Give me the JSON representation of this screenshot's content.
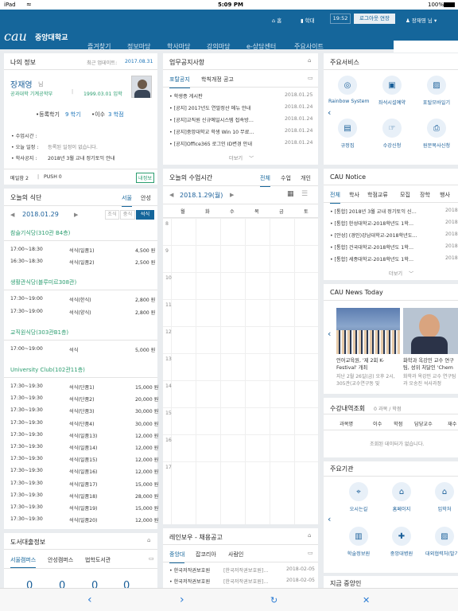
{
  "status": {
    "device": "iPad",
    "time": "5:09 PM",
    "battery": "100%"
  },
  "top": {
    "home": "홈",
    "school": "학대",
    "timer": "19:52",
    "extend": "로그아웃 연장",
    "user": "장재영 님"
  },
  "brand": {
    "logo": "cau",
    "name": "중앙대학교"
  },
  "nav": [
    "즐겨찾기",
    "정보마당",
    "학사마당",
    "강의마당",
    "e-상담센터",
    "주요사이트"
  ],
  "info": {
    "title": "나의 정보",
    "update_label": "최근 업데이트:",
    "update_date": "2017.08.31",
    "name": "장재영",
    "honorific": "님",
    "dept": "공과대학 기계공학부",
    "entry": "1999.03.01 입학",
    "reg_label": "•등록학기",
    "reg_val": "9 학기",
    "trans_label": "•이수",
    "trans_val": "3 학점",
    "class_time": "• 수업시간 :",
    "today_label": "• 오늘 일정 :",
    "today_val": "등록된 일정이 없습니다.",
    "notice_label": "• 학사공지 :",
    "notice_val": "2018년 3월 교내 정기토익 안내",
    "mail": "메일함 2",
    "push": "PUSH 0",
    "mypage": "내정보"
  },
  "menu": {
    "title": "오늘의 식단",
    "tabs": [
      "서울",
      "안성"
    ],
    "date": "2018.01.29",
    "meals": [
      "조식",
      "중식",
      "석식"
    ],
    "sections": [
      {
        "name": "참슬기식당(310관 B4층)",
        "rows": [
          [
            "17:00~18:30",
            "석식(일품1)",
            "4,500 원"
          ],
          [
            "16:30~18:30",
            "석식(일품2)",
            "2,500 원"
          ]
        ]
      },
      {
        "name": "생활관식당(블루미르308관)",
        "rows": [
          [
            "17:30~19:00",
            "석식(한식)",
            "2,800 원"
          ],
          [
            "17:30~19:00",
            "석식(양식)",
            "2,800 원"
          ]
        ]
      },
      {
        "name": "교직원식당(303관B1층)",
        "rows": [
          [
            "17:00~19:00",
            "석식",
            "5,000 원"
          ]
        ]
      },
      {
        "name": "University Club(102관11층)",
        "rows": [
          [
            "17:30~19:30",
            "석식(단품1)",
            "15,000 원"
          ],
          [
            "17:30~19:30",
            "석식(단품2)",
            "20,000 원"
          ],
          [
            "17:30~19:30",
            "석식(단품3)",
            "30,000 원"
          ],
          [
            "17:30~19:30",
            "석식(단품4)",
            "30,000 원"
          ],
          [
            "17:30~19:30",
            "석식(일품13)",
            "12,000 원"
          ],
          [
            "17:30~19:30",
            "석식(일품14)",
            "12,000 원"
          ],
          [
            "17:30~19:30",
            "석식(일품15)",
            "12,000 원"
          ],
          [
            "17:30~19:30",
            "석식(일품16)",
            "12,000 원"
          ],
          [
            "17:30~19:30",
            "석식(일품17)",
            "15,000 원"
          ],
          [
            "17:30~19:30",
            "석식(일품18)",
            "28,000 원"
          ],
          [
            "17:30~19:30",
            "석식(일품19)",
            "15,000 원"
          ],
          [
            "17:30~19:30",
            "석식(일품20)",
            "12,000 원"
          ]
        ]
      }
    ]
  },
  "library": {
    "title": "도서대출정보",
    "tabs": [
      "서울캠퍼스",
      "안성캠퍼스",
      "법학도서관"
    ],
    "counts": [
      "0",
      "0",
      "0",
      "0"
    ]
  },
  "work": {
    "title": "업무공지사항",
    "tabs": [
      "포탈공지",
      "학칙개정 공고"
    ],
    "items": [
      [
        "• 학생증 게시판",
        "2018.01.25"
      ],
      [
        "• [공지] 2017년도 연말정산 메뉴 안내",
        "2018.01.24"
      ],
      [
        "• [공지]교직원 신규예일시스템 접속방…",
        "2018.01.24"
      ],
      [
        "• [공지]중앙대학교 학생 Win 10 무료…",
        "2018.01.24"
      ],
      [
        "• [공지]Office365 로그인 ID변경 안내",
        "2018.01.24"
      ]
    ],
    "more": "더보기"
  },
  "schedule": {
    "title": "오늘의 수업시간",
    "tabs": [
      "전체",
      "수업",
      "개인"
    ],
    "date": "2018.1.29(월)",
    "days": [
      "월",
      "화",
      "수",
      "목",
      "금",
      "토"
    ],
    "hours": [
      "8",
      "9",
      "10",
      "11",
      "12",
      "13",
      "14",
      "15",
      "16",
      "17"
    ]
  },
  "rainbow": {
    "title": "레인보우 - 채용공고",
    "tabs": [
      "중앙대",
      "잡코리아",
      "사람인"
    ],
    "items": [
      [
        "• 한국저작권보호원",
        "[한국저작권보호원]…",
        "2018-02-05"
      ],
      [
        "• 한국저작권보호원",
        "[한국저작권보호원]…",
        "2018-02-05"
      ]
    ]
  },
  "services": {
    "title": "주요서비스",
    "items": [
      "Rainbow System",
      "좌석시설예약",
      "포탈모바일기",
      "규정집",
      "수강신청",
      "원문복사신청"
    ]
  },
  "cau_notice": {
    "title": "CAU Notice",
    "tabs": [
      "전체",
      "학사",
      "학점교류",
      "모집",
      "장학",
      "행사"
    ],
    "items": [
      [
        "• [통합] 2018년 3월 교내 정기토익 신…",
        "2018"
      ],
      [
        "• [통합] 한성대학교-2018학년도 1학…",
        "2018"
      ],
      [
        "• [안성] (경인)강남대학교-2018학년도…",
        "2018"
      ],
      [
        "• [통합] 건국대학교-2018학년도 1학…",
        "2018"
      ],
      [
        "• [통합] 세종대학교-2018학년도 1학…",
        "2018"
      ]
    ],
    "more": "더보기"
  },
  "news": {
    "title": "CAU News Today",
    "items": [
      {
        "head": "언어교육원, '제 2회 K-Festival' 개최",
        "body": "지난 2월 26일(금) 오후 2시, 305관(교수연구동 및"
      },
      {
        "head": "화학과 옥강민 교수 연구팀, 성위 처달인 'Chem",
        "body": "화학과 옥강민 교수 연구팀 과 오송진 석사과정"
      }
    ]
  },
  "course": {
    "title": "수강내역조회",
    "meta": "0 과목 / 학점",
    "cols": [
      "과목명",
      "이수",
      "학점",
      "담당교수",
      "재수"
    ],
    "empty": "조회된 데이터가 없습니다."
  },
  "orgs": {
    "title": "주요기관",
    "items": [
      "오시는길",
      "홈페이지",
      "입학처",
      "학술정보원",
      "중앙대병원",
      "대외협력처(발기금)"
    ]
  },
  "now": {
    "title": "지금 중앙인"
  },
  "colors": {
    "primary": "#15669b",
    "accent": "#1a73b8"
  }
}
